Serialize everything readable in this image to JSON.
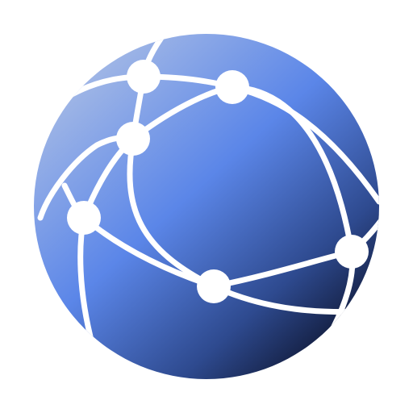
{
  "icon": {
    "name": "network-globe-icon",
    "colors": {
      "background": "#ffffff",
      "sphere_light": "#a8bce6",
      "sphere_mid": "#5b86e8",
      "sphere_dark": "#2e4a8f",
      "sphere_shadow": "#0f1733",
      "lines": "#ffffff"
    }
  }
}
